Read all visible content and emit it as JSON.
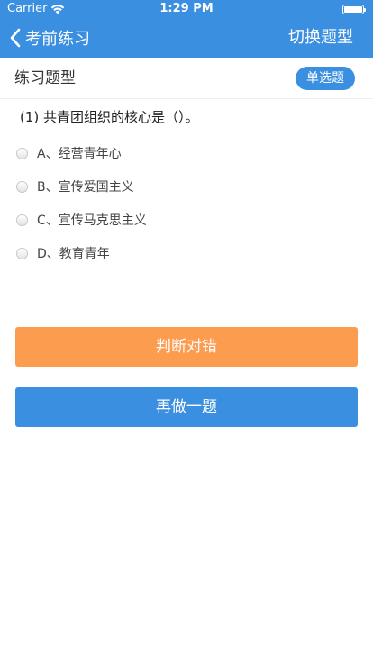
{
  "status_bar": {
    "carrier": "Carrier",
    "time": "1:29 PM",
    "battery_level": 1.0
  },
  "nav": {
    "back_label": "考前练习",
    "switch_label": "切换题型"
  },
  "section": {
    "title": "练习题型",
    "type_badge": "单选题"
  },
  "question": {
    "text": "(1) 共青团组织的核心是（）。",
    "options": [
      {
        "label": "A、经营青年心"
      },
      {
        "label": "B、宣传爱国主义"
      },
      {
        "label": "C、宣传马克思主义"
      },
      {
        "label": "D、教育青年"
      }
    ]
  },
  "buttons": {
    "judge_label": "判断对错",
    "again_label": "再做一题"
  },
  "colors": {
    "primary": "#3b8fe0",
    "judge": "#fb9c4f"
  }
}
